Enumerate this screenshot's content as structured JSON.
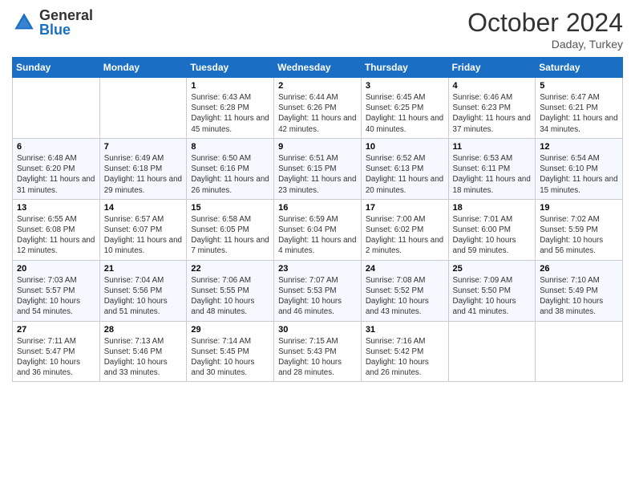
{
  "logo": {
    "general": "General",
    "blue": "Blue"
  },
  "header": {
    "month": "October 2024",
    "location": "Daday, Turkey"
  },
  "days_of_week": [
    "Sunday",
    "Monday",
    "Tuesday",
    "Wednesday",
    "Thursday",
    "Friday",
    "Saturday"
  ],
  "weeks": [
    [
      {
        "day": "",
        "info": ""
      },
      {
        "day": "",
        "info": ""
      },
      {
        "day": "1",
        "info": "Sunrise: 6:43 AM\nSunset: 6:28 PM\nDaylight: 11 hours and 45 minutes."
      },
      {
        "day": "2",
        "info": "Sunrise: 6:44 AM\nSunset: 6:26 PM\nDaylight: 11 hours and 42 minutes."
      },
      {
        "day": "3",
        "info": "Sunrise: 6:45 AM\nSunset: 6:25 PM\nDaylight: 11 hours and 40 minutes."
      },
      {
        "day": "4",
        "info": "Sunrise: 6:46 AM\nSunset: 6:23 PM\nDaylight: 11 hours and 37 minutes."
      },
      {
        "day": "5",
        "info": "Sunrise: 6:47 AM\nSunset: 6:21 PM\nDaylight: 11 hours and 34 minutes."
      }
    ],
    [
      {
        "day": "6",
        "info": "Sunrise: 6:48 AM\nSunset: 6:20 PM\nDaylight: 11 hours and 31 minutes."
      },
      {
        "day": "7",
        "info": "Sunrise: 6:49 AM\nSunset: 6:18 PM\nDaylight: 11 hours and 29 minutes."
      },
      {
        "day": "8",
        "info": "Sunrise: 6:50 AM\nSunset: 6:16 PM\nDaylight: 11 hours and 26 minutes."
      },
      {
        "day": "9",
        "info": "Sunrise: 6:51 AM\nSunset: 6:15 PM\nDaylight: 11 hours and 23 minutes."
      },
      {
        "day": "10",
        "info": "Sunrise: 6:52 AM\nSunset: 6:13 PM\nDaylight: 11 hours and 20 minutes."
      },
      {
        "day": "11",
        "info": "Sunrise: 6:53 AM\nSunset: 6:11 PM\nDaylight: 11 hours and 18 minutes."
      },
      {
        "day": "12",
        "info": "Sunrise: 6:54 AM\nSunset: 6:10 PM\nDaylight: 11 hours and 15 minutes."
      }
    ],
    [
      {
        "day": "13",
        "info": "Sunrise: 6:55 AM\nSunset: 6:08 PM\nDaylight: 11 hours and 12 minutes."
      },
      {
        "day": "14",
        "info": "Sunrise: 6:57 AM\nSunset: 6:07 PM\nDaylight: 11 hours and 10 minutes."
      },
      {
        "day": "15",
        "info": "Sunrise: 6:58 AM\nSunset: 6:05 PM\nDaylight: 11 hours and 7 minutes."
      },
      {
        "day": "16",
        "info": "Sunrise: 6:59 AM\nSunset: 6:04 PM\nDaylight: 11 hours and 4 minutes."
      },
      {
        "day": "17",
        "info": "Sunrise: 7:00 AM\nSunset: 6:02 PM\nDaylight: 11 hours and 2 minutes."
      },
      {
        "day": "18",
        "info": "Sunrise: 7:01 AM\nSunset: 6:00 PM\nDaylight: 10 hours and 59 minutes."
      },
      {
        "day": "19",
        "info": "Sunrise: 7:02 AM\nSunset: 5:59 PM\nDaylight: 10 hours and 56 minutes."
      }
    ],
    [
      {
        "day": "20",
        "info": "Sunrise: 7:03 AM\nSunset: 5:57 PM\nDaylight: 10 hours and 54 minutes."
      },
      {
        "day": "21",
        "info": "Sunrise: 7:04 AM\nSunset: 5:56 PM\nDaylight: 10 hours and 51 minutes."
      },
      {
        "day": "22",
        "info": "Sunrise: 7:06 AM\nSunset: 5:55 PM\nDaylight: 10 hours and 48 minutes."
      },
      {
        "day": "23",
        "info": "Sunrise: 7:07 AM\nSunset: 5:53 PM\nDaylight: 10 hours and 46 minutes."
      },
      {
        "day": "24",
        "info": "Sunrise: 7:08 AM\nSunset: 5:52 PM\nDaylight: 10 hours and 43 minutes."
      },
      {
        "day": "25",
        "info": "Sunrise: 7:09 AM\nSunset: 5:50 PM\nDaylight: 10 hours and 41 minutes."
      },
      {
        "day": "26",
        "info": "Sunrise: 7:10 AM\nSunset: 5:49 PM\nDaylight: 10 hours and 38 minutes."
      }
    ],
    [
      {
        "day": "27",
        "info": "Sunrise: 7:11 AM\nSunset: 5:47 PM\nDaylight: 10 hours and 36 minutes."
      },
      {
        "day": "28",
        "info": "Sunrise: 7:13 AM\nSunset: 5:46 PM\nDaylight: 10 hours and 33 minutes."
      },
      {
        "day": "29",
        "info": "Sunrise: 7:14 AM\nSunset: 5:45 PM\nDaylight: 10 hours and 30 minutes."
      },
      {
        "day": "30",
        "info": "Sunrise: 7:15 AM\nSunset: 5:43 PM\nDaylight: 10 hours and 28 minutes."
      },
      {
        "day": "31",
        "info": "Sunrise: 7:16 AM\nSunset: 5:42 PM\nDaylight: 10 hours and 26 minutes."
      },
      {
        "day": "",
        "info": ""
      },
      {
        "day": "",
        "info": ""
      }
    ]
  ]
}
